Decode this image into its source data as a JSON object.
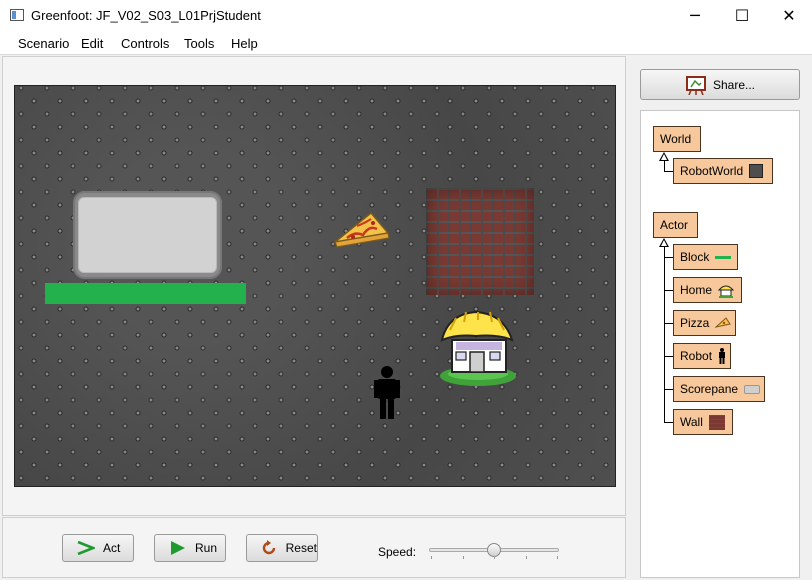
{
  "window": {
    "title": "Greenfoot: JF_V02_S03_L01PrjStudent",
    "minimize": "─",
    "maximize": "☐",
    "close": "✕"
  },
  "menu": [
    "Scenario",
    "Edit",
    "Controls",
    "Tools",
    "Help"
  ],
  "controls": {
    "act": "Act",
    "run": "Run",
    "reset": "Reset",
    "speed_label": "Speed:",
    "speed_fraction": 0.5
  },
  "share": {
    "label": "Share..."
  },
  "classes": {
    "world_root": "World",
    "world_sub": [
      "RobotWorld"
    ],
    "actor_root": "Actor",
    "actor_sub": [
      "Block",
      "Home",
      "Pizza",
      "Robot",
      "Scorepane",
      "Wall"
    ]
  },
  "colors": {
    "class_bg": "#f7c89b",
    "score_bar": "#22b14c",
    "block_line": "#22b14c"
  }
}
